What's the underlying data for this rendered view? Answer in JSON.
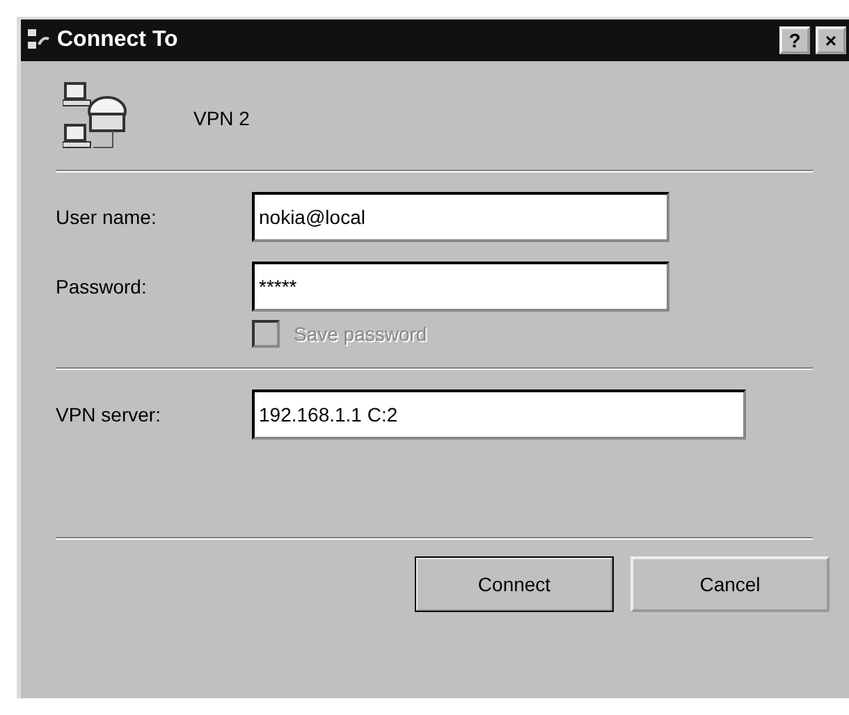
{
  "window": {
    "title": "Connect To",
    "title_buttons": [
      "?",
      "×"
    ]
  },
  "entry": {
    "name": "VPN 2"
  },
  "fields": [
    {
      "kind": "text",
      "label": "User name:",
      "value": "nokia@local"
    },
    {
      "kind": "text",
      "label": "Password:",
      "value": "*****"
    }
  ],
  "save_password": {
    "label": "Save password",
    "checked": false,
    "disabled": true
  },
  "server": {
    "label": "VPN server:",
    "value": "192.168.1.1 C:2"
  },
  "buttons": [
    {
      "label": "Connect",
      "default": true
    },
    {
      "label": "Cancel",
      "default": false
    }
  ]
}
